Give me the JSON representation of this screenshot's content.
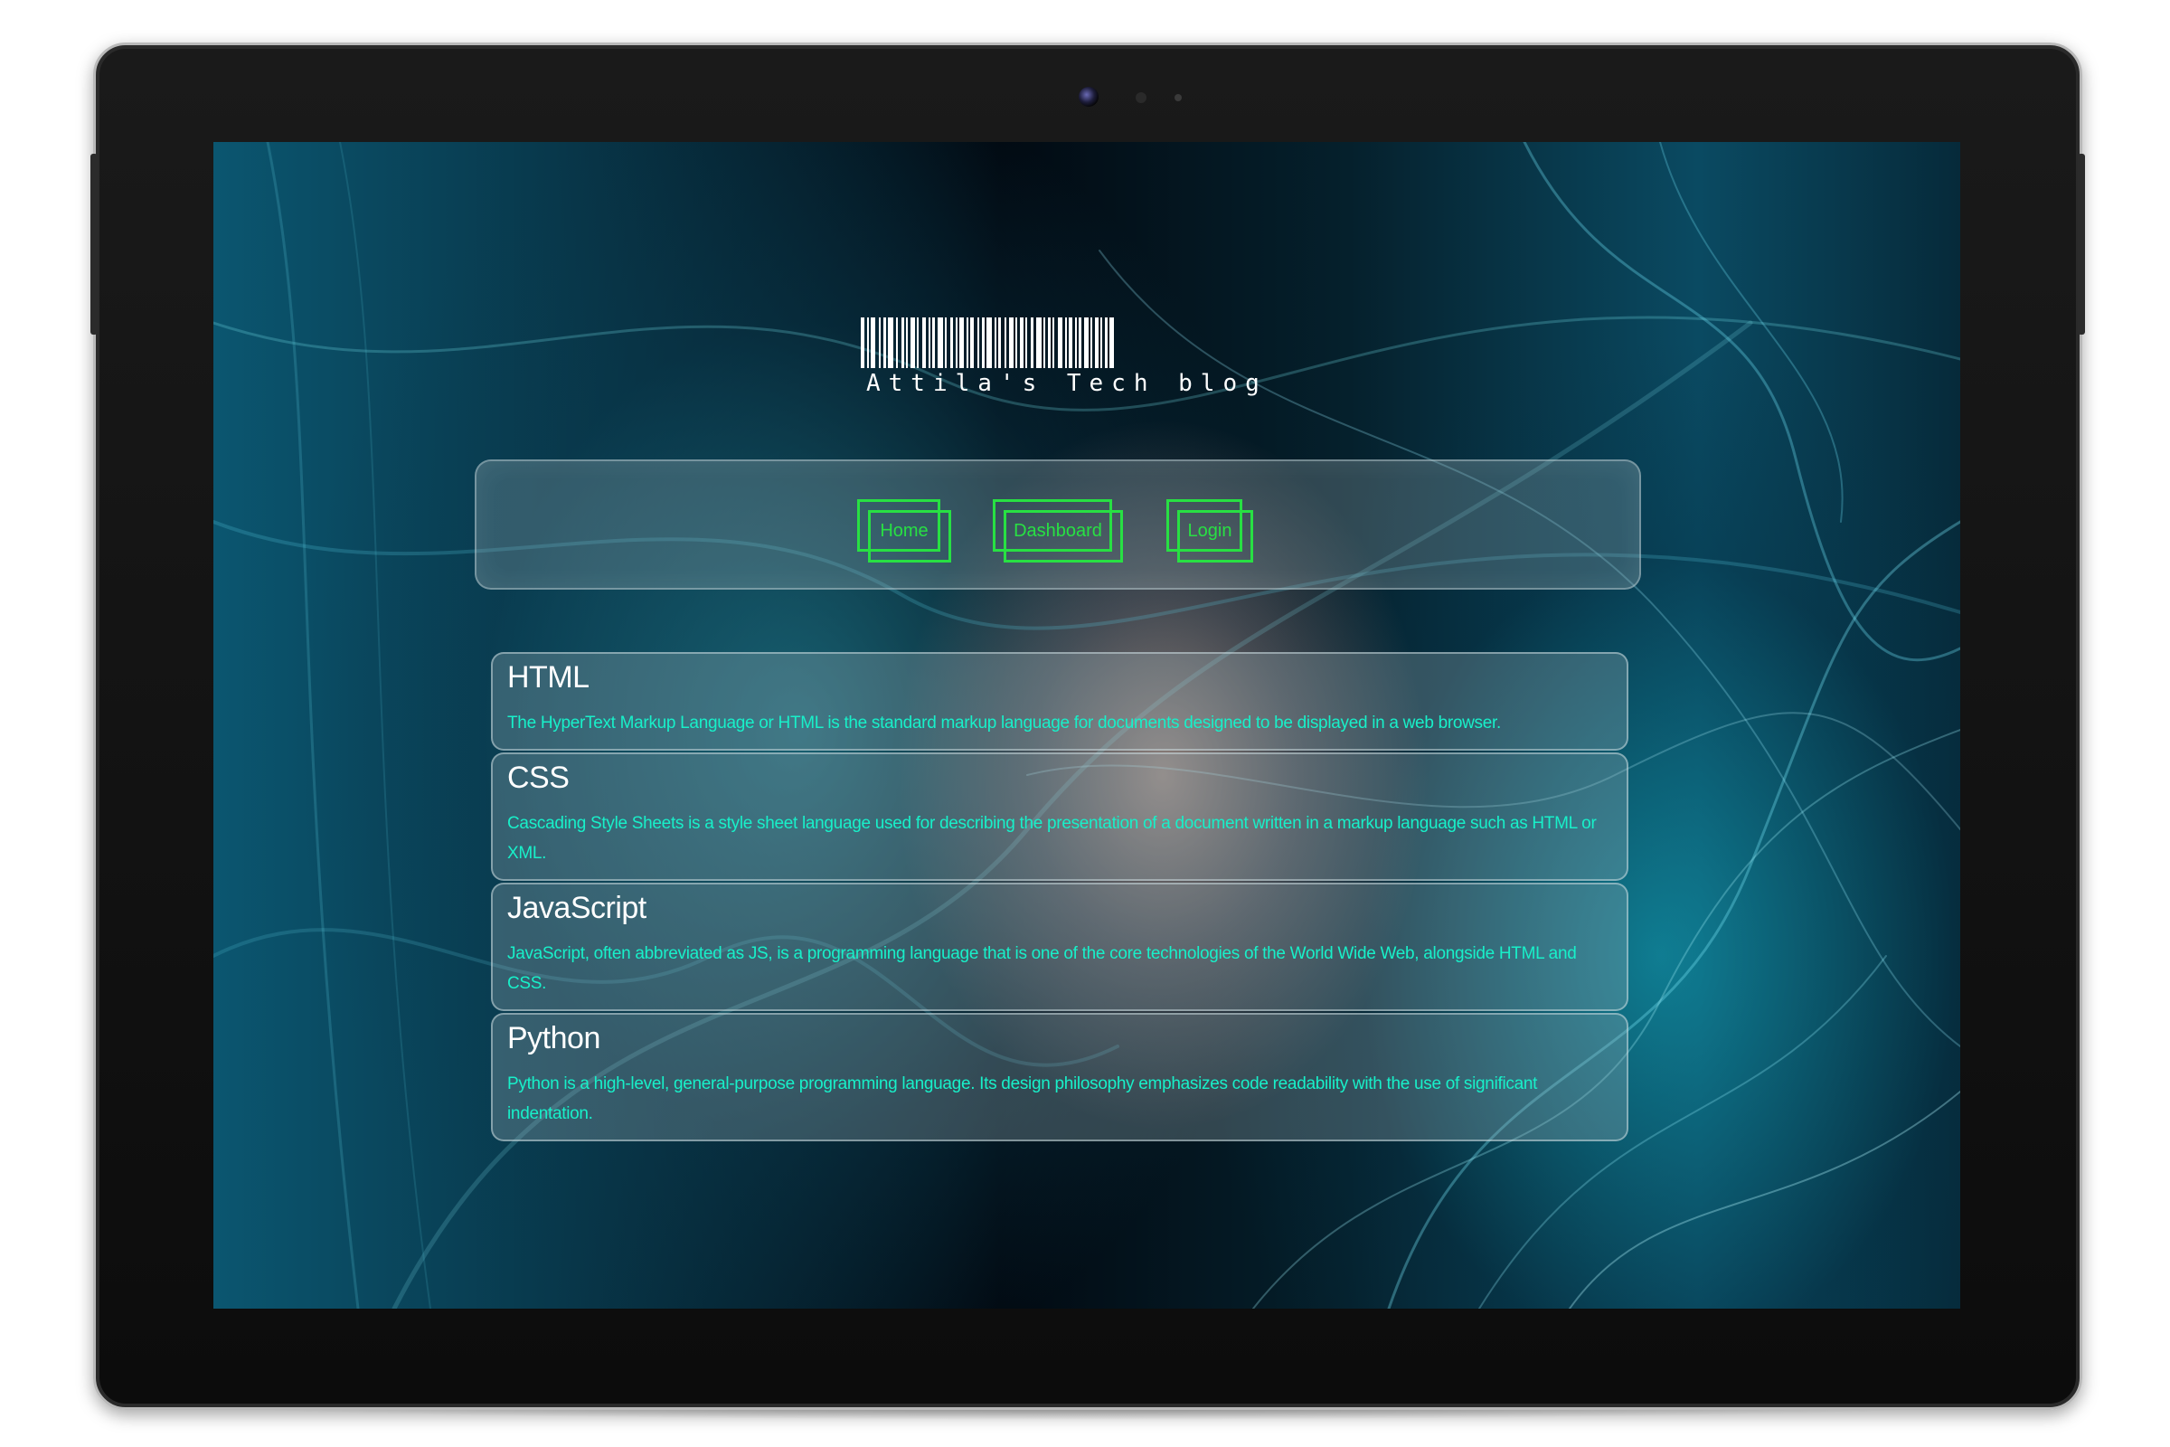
{
  "site": {
    "title": "Attila's Tech blog",
    "accent_color": "#28e043",
    "text_color": "#18f0c9"
  },
  "nav": {
    "items": [
      {
        "label": "Home"
      },
      {
        "label": "Dashboard"
      },
      {
        "label": "Login"
      }
    ]
  },
  "articles": [
    {
      "title": "HTML",
      "body": "The HyperText Markup Language or HTML is the standard markup language for documents designed to be displayed in a web browser."
    },
    {
      "title": "CSS",
      "body": "Cascading Style Sheets is a style sheet language used for describing the presentation of a document written in a markup language such as HTML or XML."
    },
    {
      "title": "JavaScript",
      "body": "JavaScript, often abbreviated as JS, is a programming language that is one of the core technologies of the World Wide Web, alongside HTML and CSS."
    },
    {
      "title": "Python",
      "body": "Python is a high-level, general-purpose programming language. Its design philosophy emphasizes code readability with the use of significant indentation."
    }
  ]
}
